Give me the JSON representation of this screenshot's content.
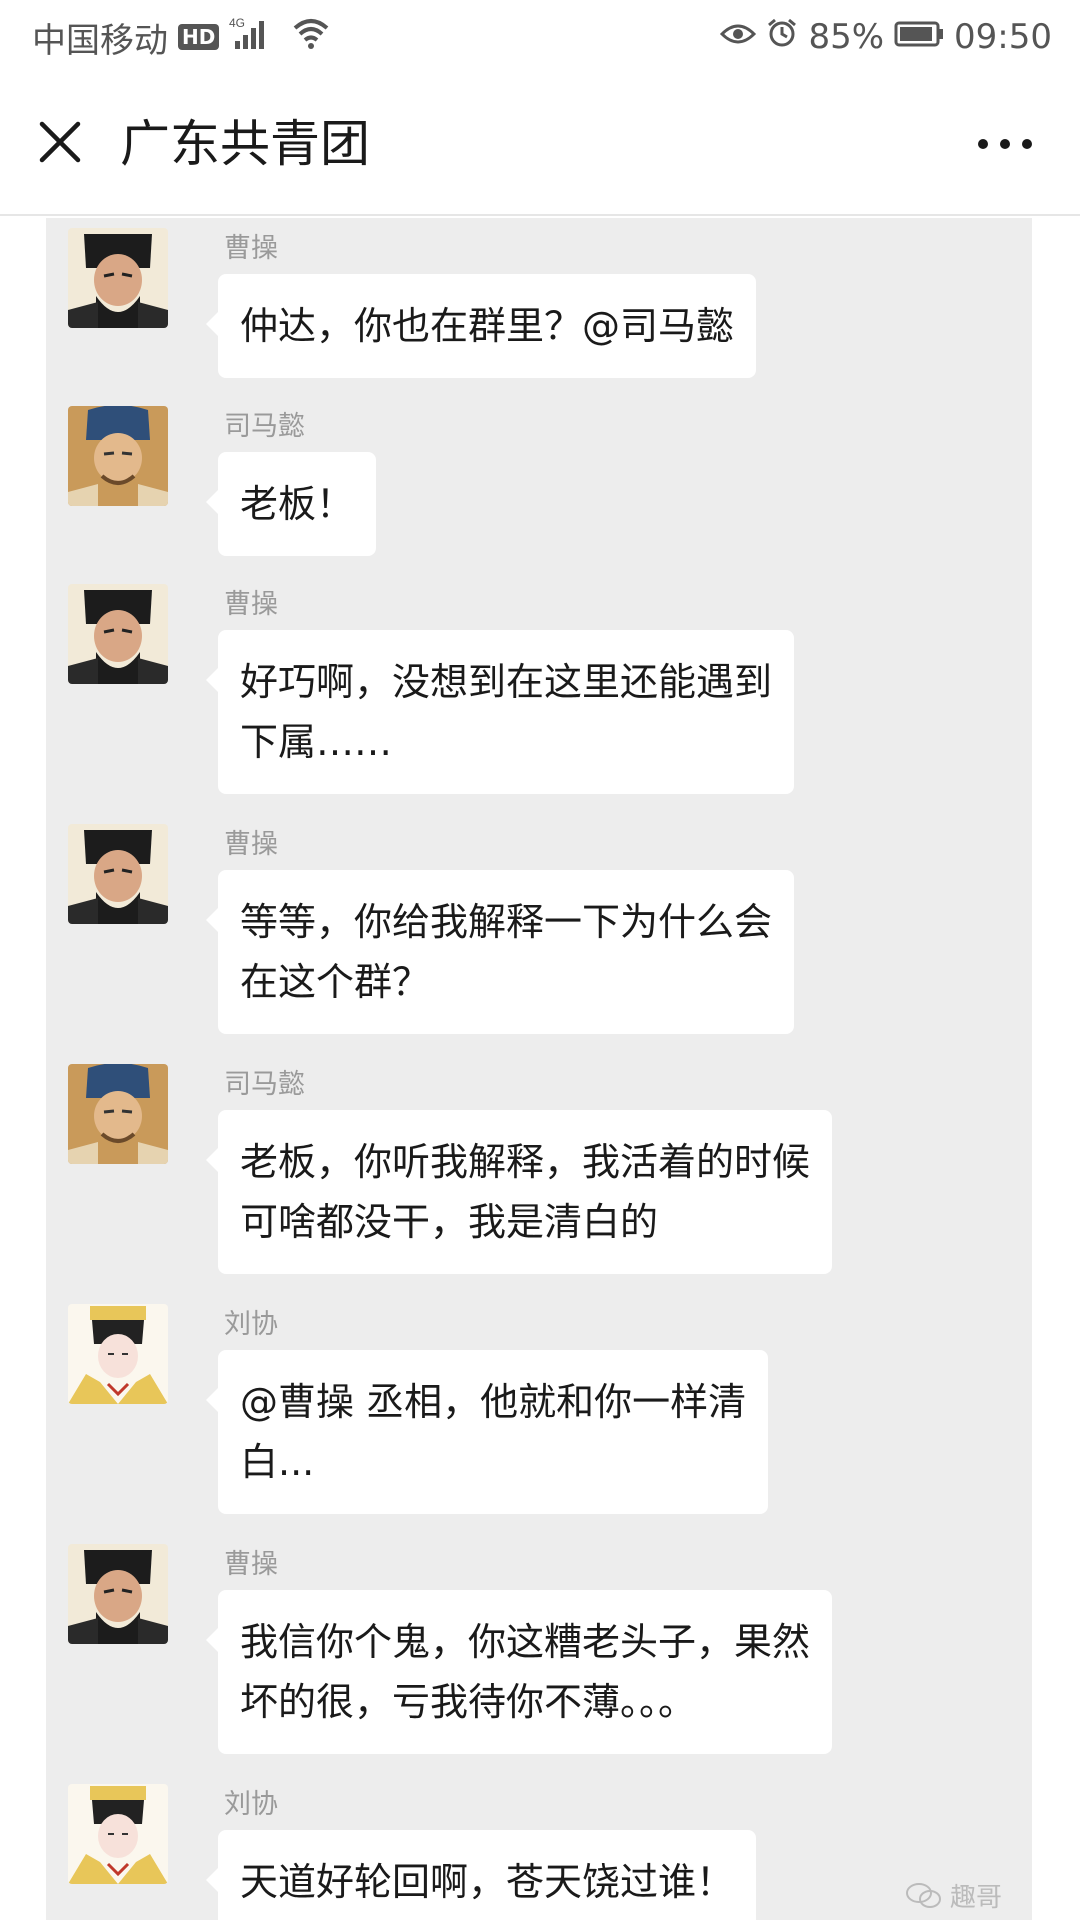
{
  "status_bar": {
    "carrier": "中国移动",
    "hd": "HD",
    "network": "4G",
    "battery": "85%",
    "time": "09:50"
  },
  "title_bar": {
    "title": "广东共青团"
  },
  "messages": [
    {
      "sender": "曹操",
      "text": "仲达，你也在群里？@司马懿"
    },
    {
      "sender": "司马懿",
      "text": "老板！"
    },
    {
      "sender": "曹操",
      "text": "好巧啊，没想到在这里还能遇到\n下属……"
    },
    {
      "sender": "曹操",
      "text": "等等，你给我解释一下为什么会\n在这个群？"
    },
    {
      "sender": "司马懿",
      "text": "老板，你听我解释，我活着的时候\n可啥都没干，我是清白的"
    },
    {
      "sender": "刘协",
      "text": "@曹操 丞相，他就和你一样清\n白..."
    },
    {
      "sender": "曹操",
      "text": "我信你个鬼，你这糟老头子，果然\n坏的很，亏我待你不薄。。。"
    },
    {
      "sender": "刘协",
      "text": "天道好轮回啊，苍天饶过谁！"
    }
  ],
  "watermark": "趣哥"
}
